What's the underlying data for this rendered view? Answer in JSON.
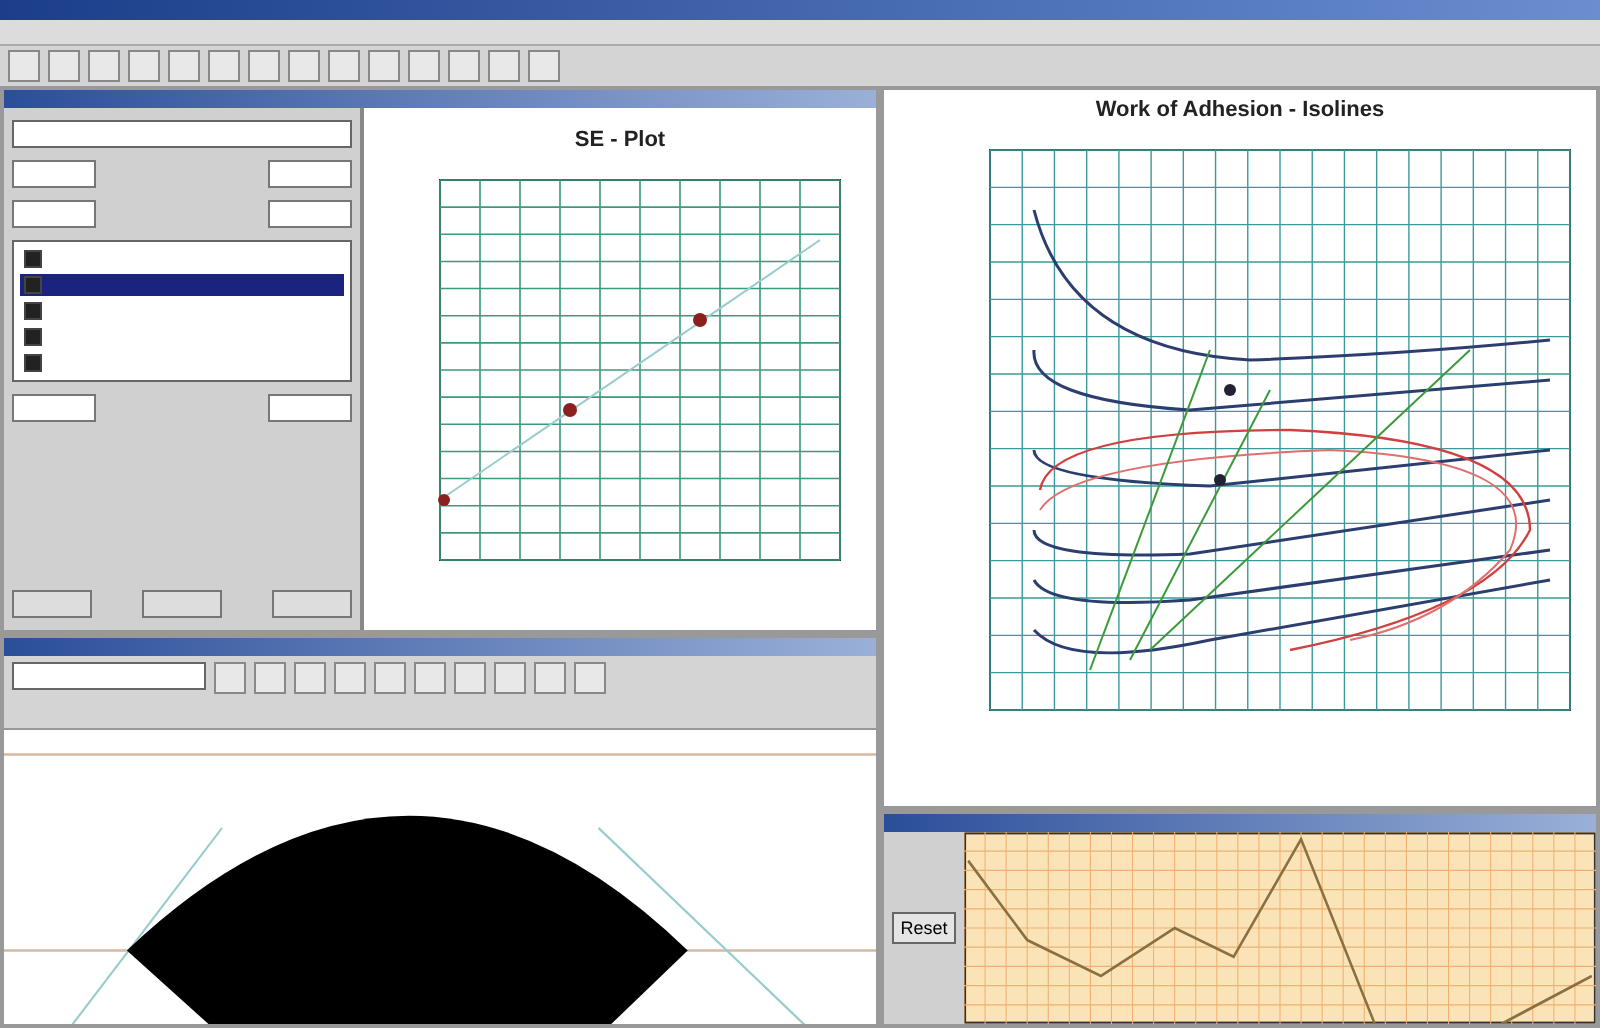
{
  "settings_panel": {
    "list_rows": [
      {
        "checked": true,
        "selected": false
      },
      {
        "checked": true,
        "selected": true
      },
      {
        "checked": true,
        "selected": false
      },
      {
        "checked": true,
        "selected": false
      },
      {
        "checked": true,
        "selected": false
      }
    ]
  },
  "se_plot": {
    "title": "SE - Plot"
  },
  "adhesion_plot": {
    "title": "Work of Adhesion - Isolines"
  },
  "trend_window": {
    "button": "Reset"
  }
}
